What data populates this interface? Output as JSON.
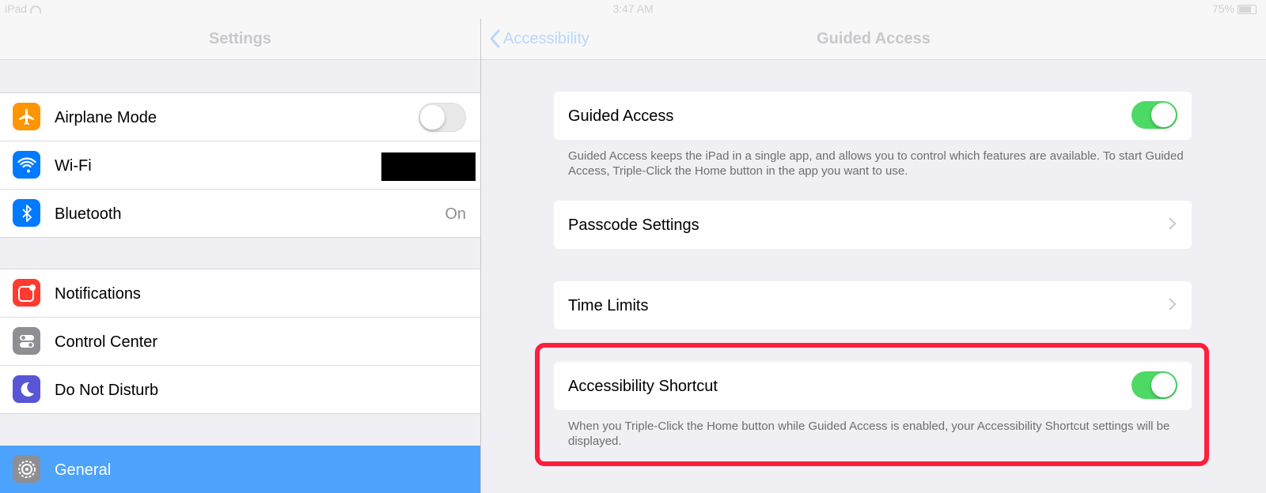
{
  "status_bar": {
    "device": "iPad",
    "time": "3:47 AM",
    "battery": "75%"
  },
  "left_pane": {
    "title": "Settings",
    "group1": [
      {
        "label": "Airplane Mode",
        "icon": "airplane-icon",
        "toggle": "off"
      },
      {
        "label": "Wi-Fi",
        "icon": "wifi-icon"
      },
      {
        "label": "Bluetooth",
        "icon": "bluetooth-icon",
        "value": "On"
      }
    ],
    "group2": [
      {
        "label": "Notifications",
        "icon": "notifications-icon"
      },
      {
        "label": "Control Center",
        "icon": "control-center-icon"
      },
      {
        "label": "Do Not Disturb",
        "icon": "moon-icon"
      }
    ],
    "selected": {
      "label": "General",
      "icon": "gear-icon"
    }
  },
  "right_pane": {
    "back_label": "Accessibility",
    "title": "Guided Access",
    "guided_access": {
      "label": "Guided Access",
      "toggle": "on",
      "footer": "Guided Access keeps the iPad in a single app, and allows you to control which features are available. To start Guided Access, Triple-Click the Home button in the app you want to use."
    },
    "passcode_settings": {
      "label": "Passcode Settings"
    },
    "time_limits": {
      "label": "Time Limits"
    },
    "accessibility_shortcut": {
      "label": "Accessibility Shortcut",
      "toggle": "on",
      "footer": "When you Triple-Click the Home button while Guided Access is enabled, your Accessibility Shortcut settings will be displayed."
    }
  },
  "colors": {
    "accent": "#4da3fb",
    "toggle_on": "#4cd964",
    "highlight": "#ff1f3d"
  }
}
